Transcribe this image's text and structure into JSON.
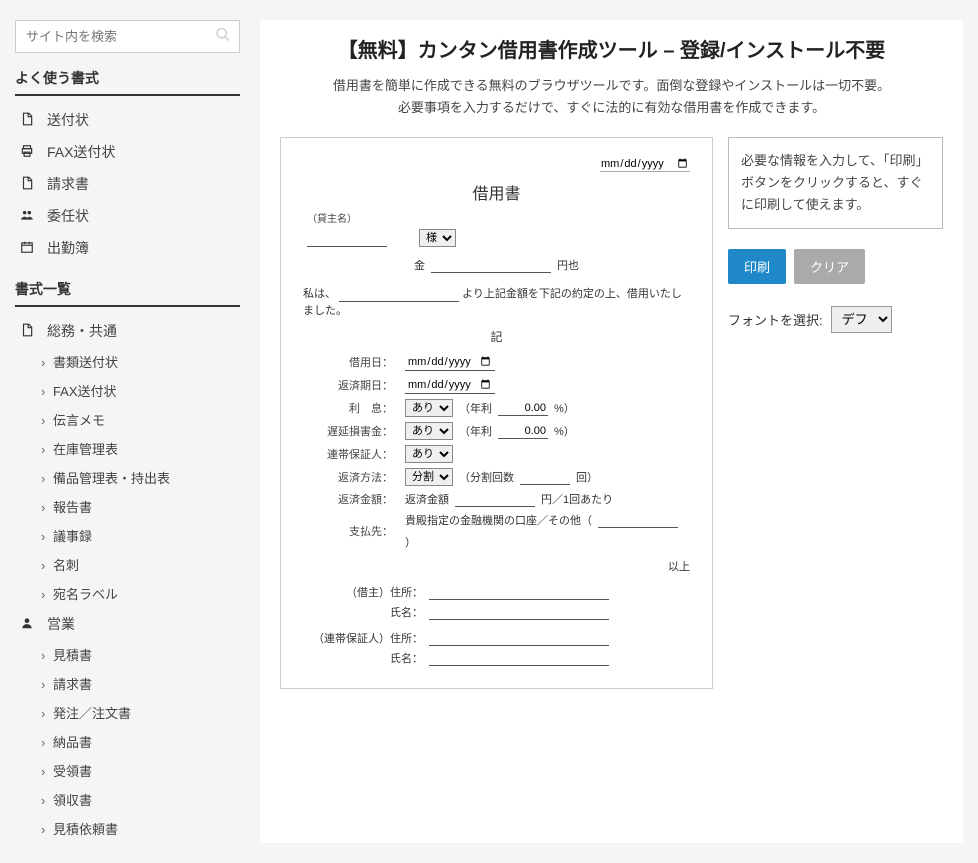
{
  "search": {
    "placeholder": "サイト内を検索"
  },
  "sidebar": {
    "heading_freq": "よく使う書式",
    "freq_items": [
      {
        "icon": "file",
        "label": "送付状"
      },
      {
        "icon": "print",
        "label": "FAX送付状"
      },
      {
        "icon": "file",
        "label": "請求書"
      },
      {
        "icon": "people",
        "label": "委任状"
      },
      {
        "icon": "calendar",
        "label": "出勤簿"
      }
    ],
    "heading_list": "書式一覧",
    "categories": [
      {
        "icon": "file",
        "label": "総務・共通",
        "children": [
          "書類送付状",
          "FAX送付状",
          "伝言メモ",
          "在庫管理表",
          "備品管理表・持出表",
          "報告書",
          "議事録",
          "名刺",
          "宛名ラベル"
        ]
      },
      {
        "icon": "person",
        "label": "営業",
        "children": [
          "見積書",
          "請求書",
          "発注／注文書",
          "納品書",
          "受領書",
          "領収書",
          "見積依頼書"
        ]
      }
    ]
  },
  "main": {
    "title": "【無料】カンタン借用書作成ツール – 登録/インストール不要",
    "desc_l1": "借用書を簡単に作成できる無料のブラウザツールです。面倒な登録やインストールは一切不要。",
    "desc_l2": "必要事項を入力するだけで、すぐに法的に有効な借用書を作成できます。"
  },
  "doc": {
    "date_placeholder": "年 /月/日",
    "title": "借用書",
    "lender_label": "（貸主名）",
    "honor_options": [
      "様"
    ],
    "kin": "金",
    "yen": "円也",
    "sentence_prefix": "私は、",
    "sentence_suffix": "より上記金額を下記の約定の上、借用いたしました。",
    "ki": "記",
    "rows": {
      "loan_date": "借用日：",
      "return_date": "返済期日：",
      "interest": "利　息：",
      "delay": "遅延損害金：",
      "guarantor": "連帯保証人：",
      "method": "返済方法：",
      "amount": "返済金額：",
      "payee": "支払先："
    },
    "yesno_options": [
      "あり"
    ],
    "method_options": [
      "分割"
    ],
    "interest_fmt": {
      "pre": "（年利",
      "val": "0.00",
      "post": " %）"
    },
    "split_fmt": {
      "pre": "（分割回数",
      "post": "回）"
    },
    "amount_fmt": {
      "pre": "返済金額",
      "mid": "円／1回あたり"
    },
    "payee_text": {
      "pre": "貴殿指定の金融機関の口座／その他（",
      "post": "）"
    },
    "ijou": "以上",
    "parties": {
      "borrower_label": "（借主）住所：",
      "name_label": "氏名：",
      "guarantor_label": "（連帯保証人）住所："
    }
  },
  "right": {
    "info": "必要な情報を入力して、「印刷」ボタンをクリックすると、すぐに印刷して使えます。",
    "print": "印刷",
    "clear": "クリア",
    "font_label": "フォントを選択:",
    "font_options": [
      "デフ"
    ]
  },
  "icons": {
    "file": "📄",
    "print": "🖨",
    "people": "👥",
    "calendar": "📅",
    "person": "👤"
  }
}
